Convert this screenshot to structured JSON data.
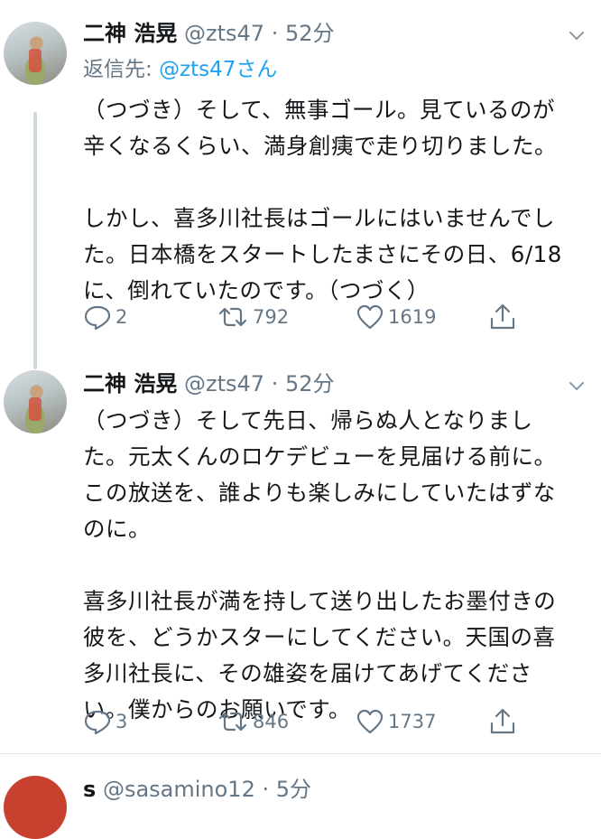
{
  "tweets": [
    {
      "name": "二神 浩晃",
      "handle": "@zts47",
      "dot": "·",
      "time": "52分",
      "reply_label": "返信先: ",
      "reply_handle": "@zts47さん",
      "text": "（つづき）そして、無事ゴール。見ているのが\n辛くなるくらい、満身創痍で走り切りました。\n\nしかし、喜多川社長はゴールにはいませんでし\nた。日本橋をスタートしたまさにその日、6/18\nに、倒れていたのです。（つづく）",
      "replies": "2",
      "retweets": "792",
      "likes": "1619"
    },
    {
      "name": "二神 浩晃",
      "handle": "@zts47",
      "dot": "·",
      "time": "52分",
      "text": "（つづき）そして先日、帰らぬ人となりまし\nた。元太くんのロケデビューを見届ける前に。\nこの放送を、誰よりも楽しみにしていたはずな\nのに。\n\n喜多川社長が満を持して送り出したお墨付きの\n彼を、どうかスターにしてください。天国の喜\n多川社長に、その雄姿を届けてあげてくださ\nい。僕からのお願いです。",
      "replies": "3",
      "retweets": "846",
      "likes": "1737"
    },
    {
      "name": "s",
      "handle": "@sasamino12",
      "dot": "·",
      "time": "5分"
    }
  ],
  "icons": [
    "reply-icon",
    "retweet-icon",
    "like-icon",
    "share-icon",
    "chevron-down-icon"
  ],
  "colors": {
    "text": "#14171a",
    "secondary": "#657786",
    "link": "#1da1f2",
    "divider": "#e1e8ed"
  }
}
